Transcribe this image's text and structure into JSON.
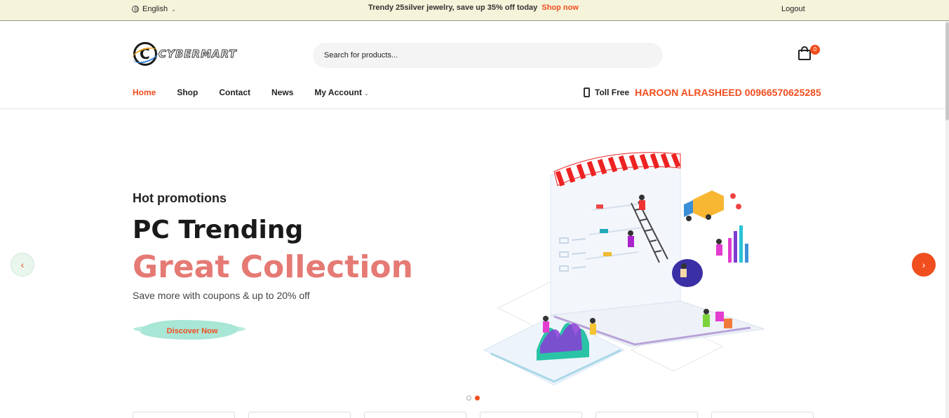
{
  "topbar": {
    "language": "English",
    "promo_text": "Trendy 25silver jewelry, save up 35% off today",
    "promo_link": "Shop now",
    "logout": "Logout"
  },
  "header": {
    "logo_text": "CYBERMART",
    "search_placeholder": "Search for products...",
    "cart_count": "0"
  },
  "nav": {
    "items": [
      {
        "label": "Home",
        "active": true
      },
      {
        "label": "Shop"
      },
      {
        "label": "Contact"
      },
      {
        "label": "News"
      },
      {
        "label": "My Account"
      }
    ],
    "toll_free_label": "Toll Free",
    "toll_free_number": "HAROON ALRASHEED 00966570625285"
  },
  "hero": {
    "subtitle": "Hot promotions",
    "title": "PC Trending",
    "title_highlight": "Great Collection",
    "description": "Save more with coupons & up to 20% off",
    "cta": "Discover Now"
  },
  "slider": {
    "slide_count": 2,
    "active_slide": 2
  },
  "colors": {
    "accent": "#f04e1e",
    "highlight": "#e57a74",
    "topbar_bg": "#f5f3da",
    "cta_brush": "#a8e6d6"
  },
  "icons": [
    "globe-icon",
    "chevron-down-icon",
    "cart-icon",
    "phone-icon",
    "arrow-left-icon",
    "arrow-right-icon"
  ]
}
